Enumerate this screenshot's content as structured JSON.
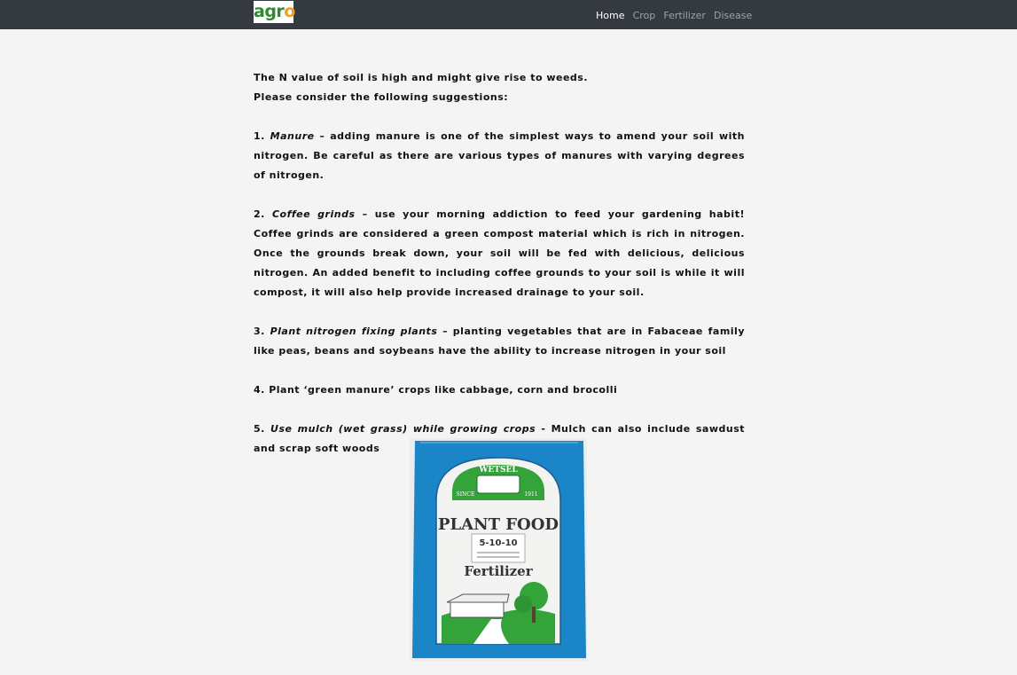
{
  "nav": {
    "logo": {
      "text_main": "agr",
      "text_accent": "o"
    },
    "links": [
      {
        "label": "Home",
        "active": true
      },
      {
        "label": "Crop",
        "active": false
      },
      {
        "label": "Fertilizer",
        "active": false
      },
      {
        "label": "Disease",
        "active": false
      }
    ]
  },
  "content": {
    "intro_line1": "The N value of soil is high and might give rise to weeds.",
    "intro_line2": "Please consider the following suggestions:",
    "suggestions": [
      {
        "num": "1.",
        "title": "Manure",
        "sep": " – ",
        "body": "adding manure is one of the simplest ways to amend your soil with nitrogen. Be careful as there are various types of manures with varying degrees of nitrogen."
      },
      {
        "num": "2.",
        "title": "Coffee grinds",
        "sep": " – ",
        "body": "use your morning addiction to feed your gardening habit! Coffee grinds are considered a green compost material which is rich in nitrogen. Once the grounds break down, your soil will be fed with delicious, delicious nitrogen. An added benefit to including coffee grounds to your soil is while it will compost, it will also help provide increased drainage to your soil."
      },
      {
        "num": "3.",
        "title": "Plant nitrogen fixing plants",
        "sep": " – ",
        "body": "planting vegetables that are in Fabaceae family like peas, beans and soybeans have the ability to increase nitrogen in your soil"
      },
      {
        "num": "4.",
        "title": "",
        "sep": "",
        "body": "Plant ‘green manure’ crops like cabbage, corn and brocolli"
      },
      {
        "num": "5.",
        "title": "Use mulch (wet grass) while growing crops",
        "sep": " - ",
        "body": "Mulch can also include sawdust and scrap soft woods"
      }
    ]
  },
  "product_image": {
    "brand": "WETSEL",
    "since_left": "SINCE",
    "since_right": "1911",
    "title": "PLANT FOOD",
    "npk": "5-10-10",
    "subtitle": "Fertilizer",
    "colors": {
      "bag": "#1a86c7",
      "panel": "#f3f3f1",
      "green": "#33a33a"
    }
  }
}
